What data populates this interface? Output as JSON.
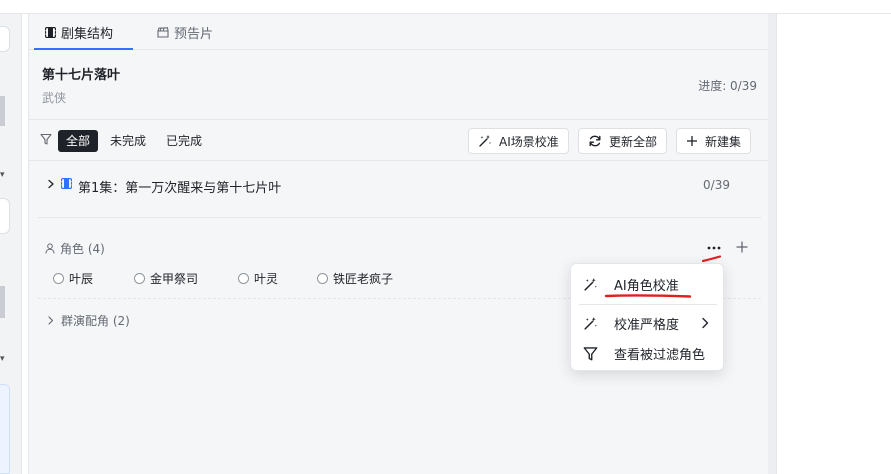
{
  "tabs": [
    {
      "label": "剧集结构",
      "icon": "film-icon",
      "active": true
    },
    {
      "label": "预告片",
      "icon": "clapper-icon",
      "active": false
    }
  ],
  "project": {
    "title": "第十七片落叶",
    "genre": "武侠",
    "progress": "进度: 0/39"
  },
  "filters": [
    {
      "label": "全部",
      "active": true
    },
    {
      "label": "未完成",
      "active": false
    },
    {
      "label": "已完成",
      "active": false
    }
  ],
  "toolbar": {
    "ai_scene_label": "AI场景校准",
    "refresh_label": "更新全部",
    "new_episode_label": "新建集"
  },
  "episode": {
    "name": "第1集：第一万次醒来与第十七片叶",
    "count": "0/39"
  },
  "roles": {
    "header": "角色 (4)",
    "items": [
      "叶辰",
      "金甲祭司",
      "叶灵",
      "铁匠老疯子"
    ]
  },
  "group": {
    "label": "群演配角 (2)"
  },
  "menu": {
    "items": [
      {
        "label": "AI角色校准",
        "icon": "magic-wand-icon"
      },
      {
        "label": "校准严格度",
        "icon": "magic-wand-icon",
        "submenu": true
      },
      {
        "label": "查看被过滤角色",
        "icon": "filter-icon"
      }
    ]
  },
  "colors": {
    "accent": "#3370ff",
    "annotation": "#e02020",
    "dark_pill": "#1f2329"
  }
}
